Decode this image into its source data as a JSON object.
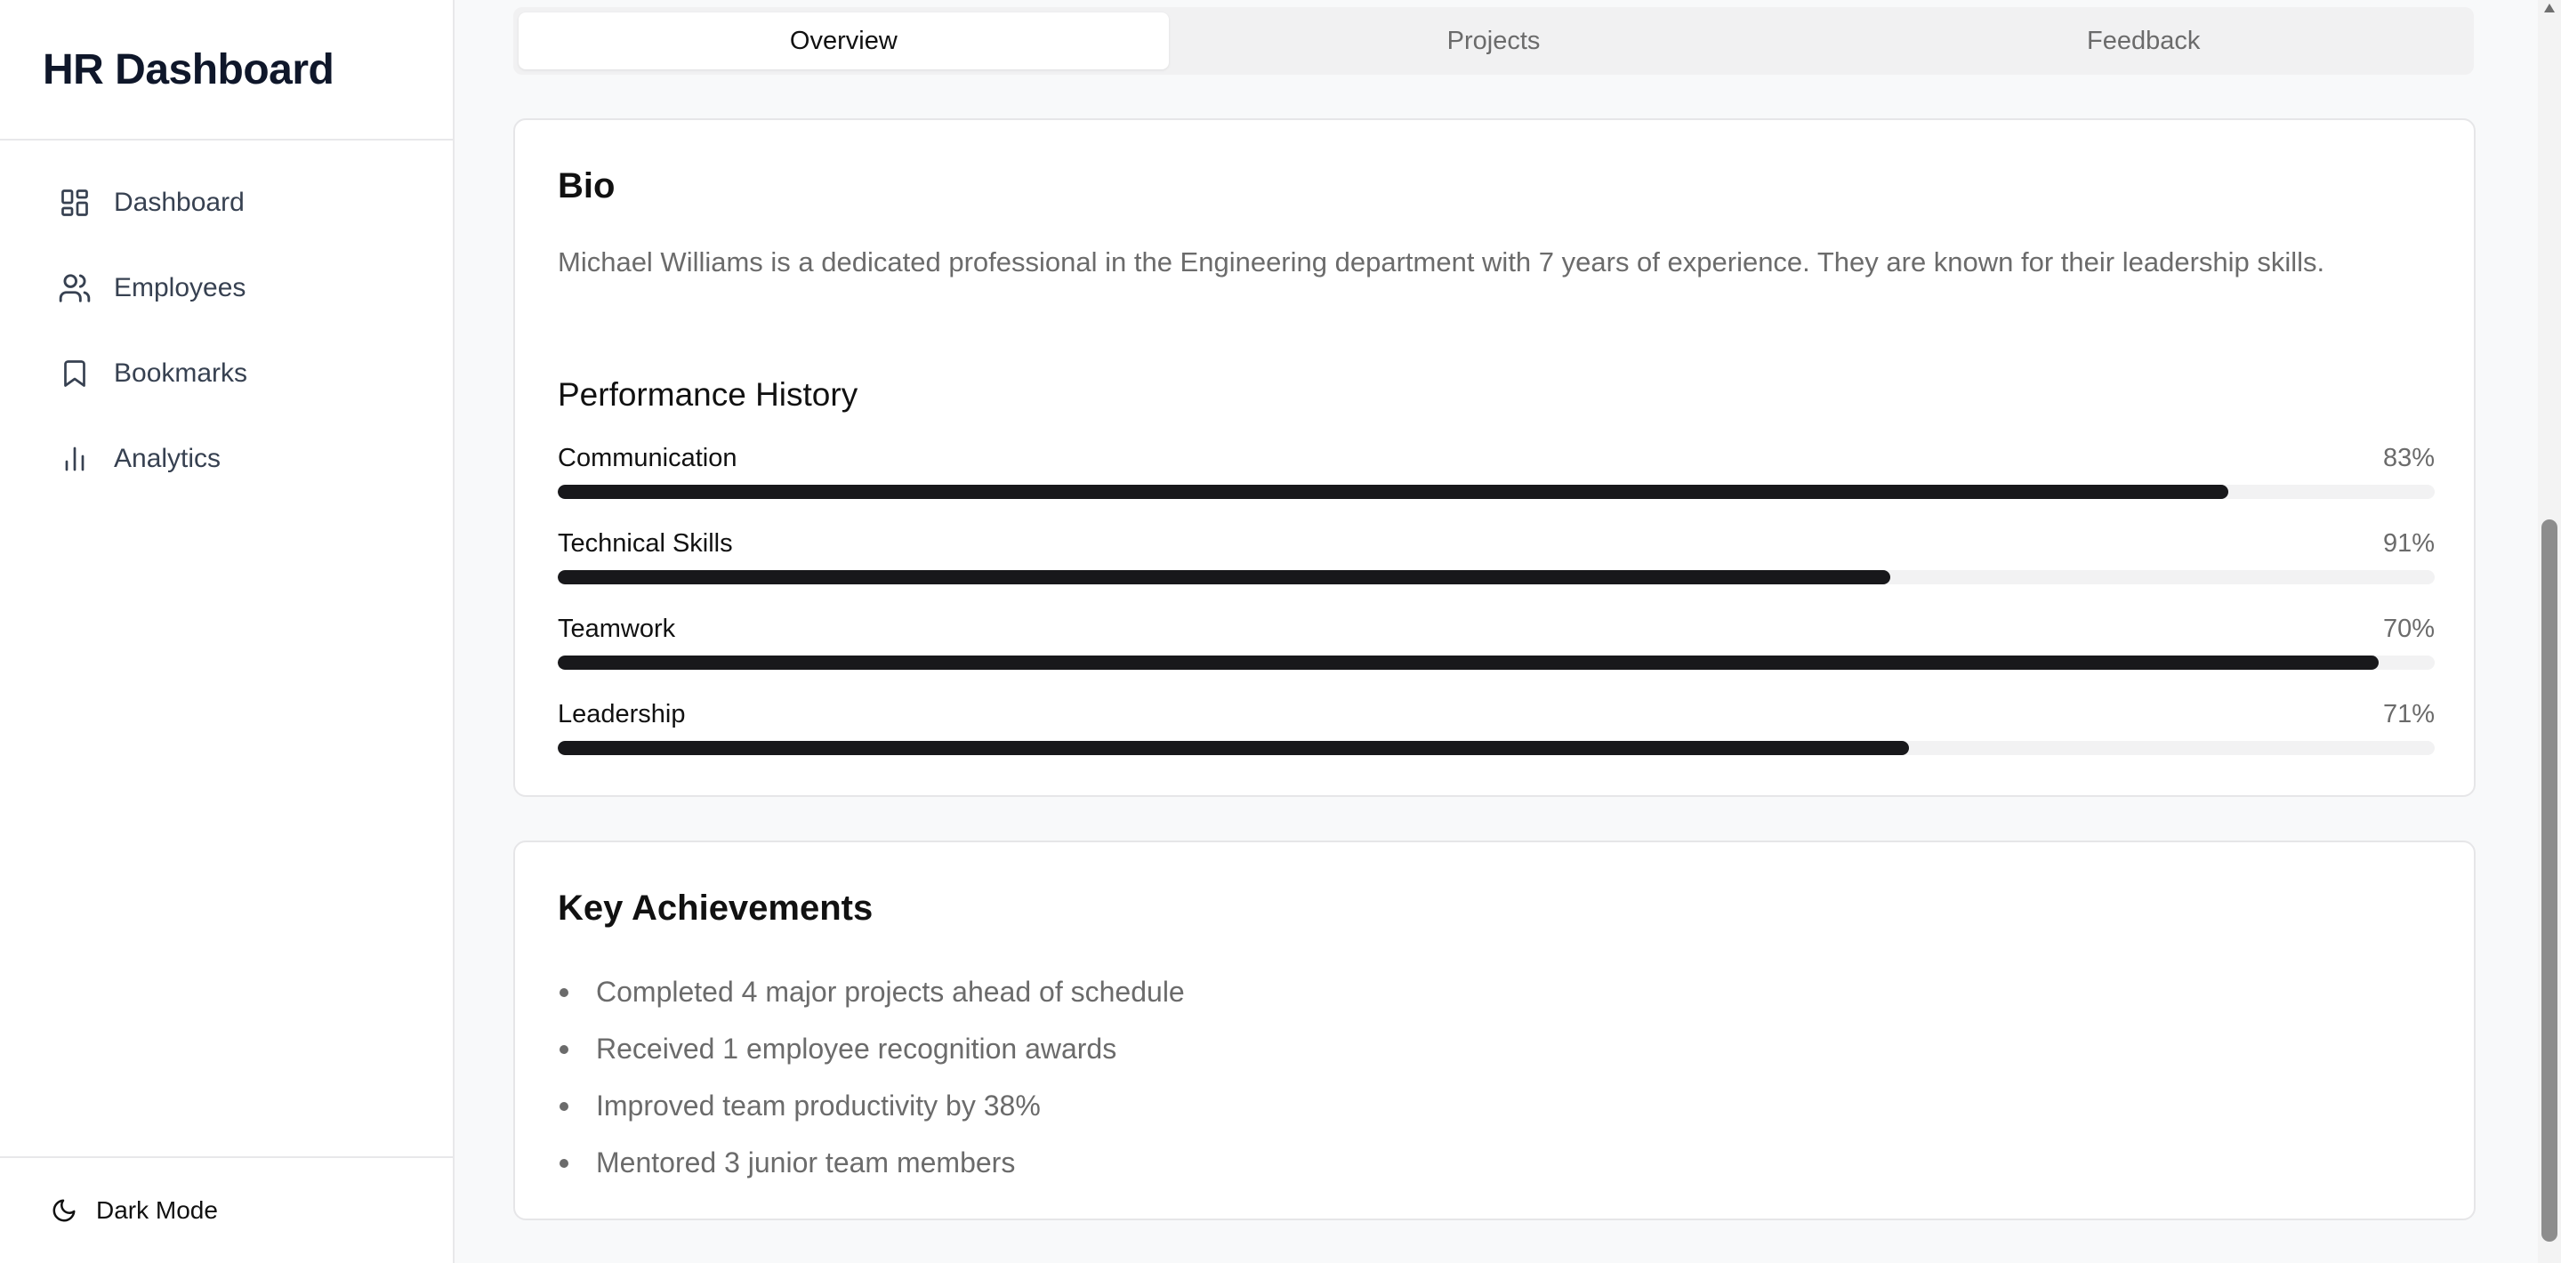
{
  "sidebar": {
    "title": "HR Dashboard",
    "items": [
      {
        "label": "Dashboard",
        "icon": "dashboard-icon"
      },
      {
        "label": "Employees",
        "icon": "users-icon"
      },
      {
        "label": "Bookmarks",
        "icon": "bookmark-icon"
      },
      {
        "label": "Analytics",
        "icon": "bar-chart-icon"
      }
    ],
    "footer": {
      "label": "Dark Mode",
      "icon": "moon-icon"
    }
  },
  "tabs": [
    {
      "label": "Overview",
      "active": true
    },
    {
      "label": "Projects",
      "active": false
    },
    {
      "label": "Feedback",
      "active": false
    }
  ],
  "bio": {
    "title": "Bio",
    "text": "Michael Williams is a dedicated professional in the Engineering department with 7 years of experience. They are known for their leadership skills."
  },
  "performance": {
    "title": "Performance History",
    "metrics": [
      {
        "name": "Communication",
        "value": "83%",
        "bar_fill": 0.89
      },
      {
        "name": "Technical Skills",
        "value": "91%",
        "bar_fill": 0.71
      },
      {
        "name": "Teamwork",
        "value": "70%",
        "bar_fill": 0.97
      },
      {
        "name": "Leadership",
        "value": "71%",
        "bar_fill": 0.72
      }
    ]
  },
  "achievements": {
    "title": "Key Achievements",
    "items": [
      "Completed 4 major projects ahead of schedule",
      "Received 1 employee recognition awards",
      "Improved team productivity by 38%",
      "Mentored 3 junior team members"
    ]
  },
  "colors": {
    "bar_fill": "#18181b",
    "bar_track": "#f2f2f3",
    "muted_text": "#6b6b6b"
  }
}
